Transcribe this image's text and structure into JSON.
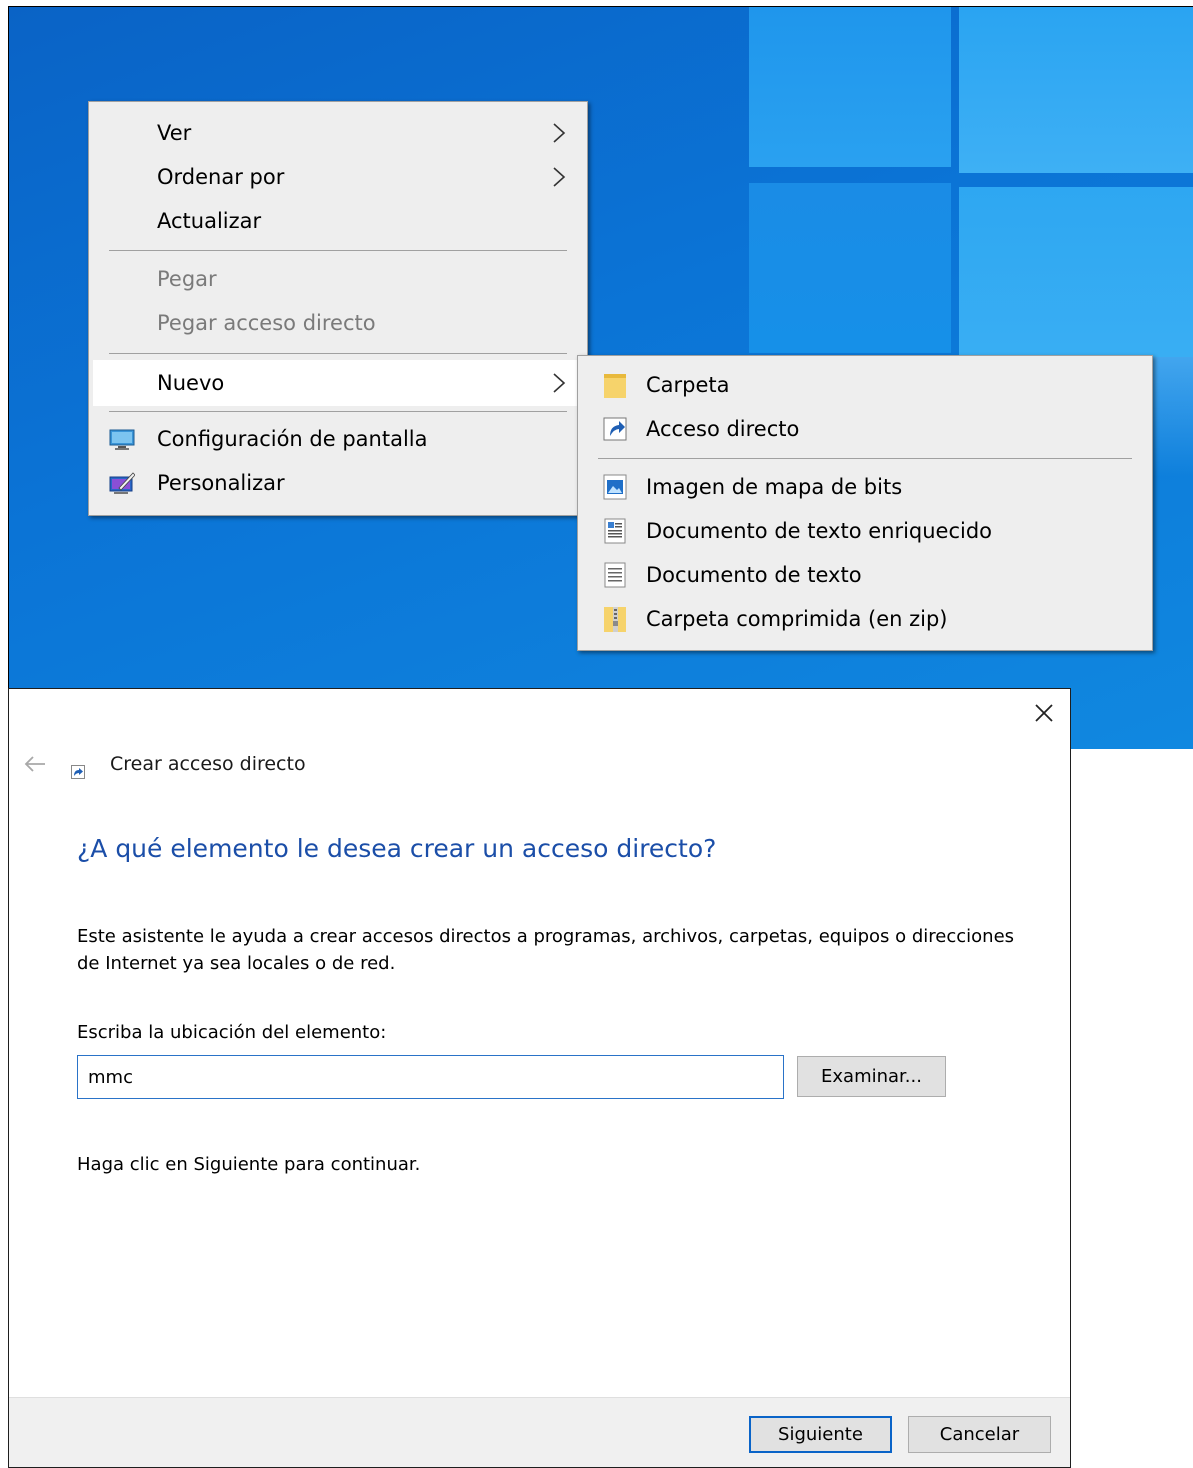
{
  "desktop": {
    "wallpaper": "windows-10-hero"
  },
  "context_menu": {
    "items": [
      {
        "label": "Ver",
        "submenu": true
      },
      {
        "label": "Ordenar por",
        "submenu": true
      },
      {
        "label": "Actualizar"
      },
      {
        "label": "Pegar",
        "disabled": true
      },
      {
        "label": "Pegar acceso directo",
        "disabled": true
      },
      {
        "label": "Nuevo",
        "submenu": true,
        "highlighted": true
      },
      {
        "label": "Configuración de pantalla",
        "icon": "display-settings-icon"
      },
      {
        "label": "Personalizar",
        "icon": "personalize-icon"
      }
    ]
  },
  "new_submenu": {
    "items": [
      {
        "label": "Carpeta",
        "icon": "folder-icon"
      },
      {
        "label": "Acceso directo",
        "icon": "shortcut-icon"
      },
      {
        "label": "Imagen de mapa de bits",
        "icon": "bitmap-icon"
      },
      {
        "label": "Documento de texto enriquecido",
        "icon": "rich-text-icon"
      },
      {
        "label": "Documento de texto",
        "icon": "text-document-icon"
      },
      {
        "label": "Carpeta comprimida (en zip)",
        "icon": "zip-folder-icon"
      }
    ]
  },
  "dialog": {
    "title": "Crear acceso directo",
    "heading": "¿A qué elemento le desea crear un acceso directo?",
    "description": "Este asistente le ayuda a crear accesos directos a programas, archivos, carpetas, equipos o direcciones de Internet ya sea locales o de red.",
    "location_label": "Escriba la ubicación del elemento:",
    "location_value": "mmc",
    "browse_label": "Examinar...",
    "hint": "Haga clic en Siguiente para continuar.",
    "next_label": "Siguiente",
    "cancel_label": "Cancelar",
    "colors": {
      "heading": "#1b4ea8",
      "focus_border": "#0a64c8"
    }
  }
}
